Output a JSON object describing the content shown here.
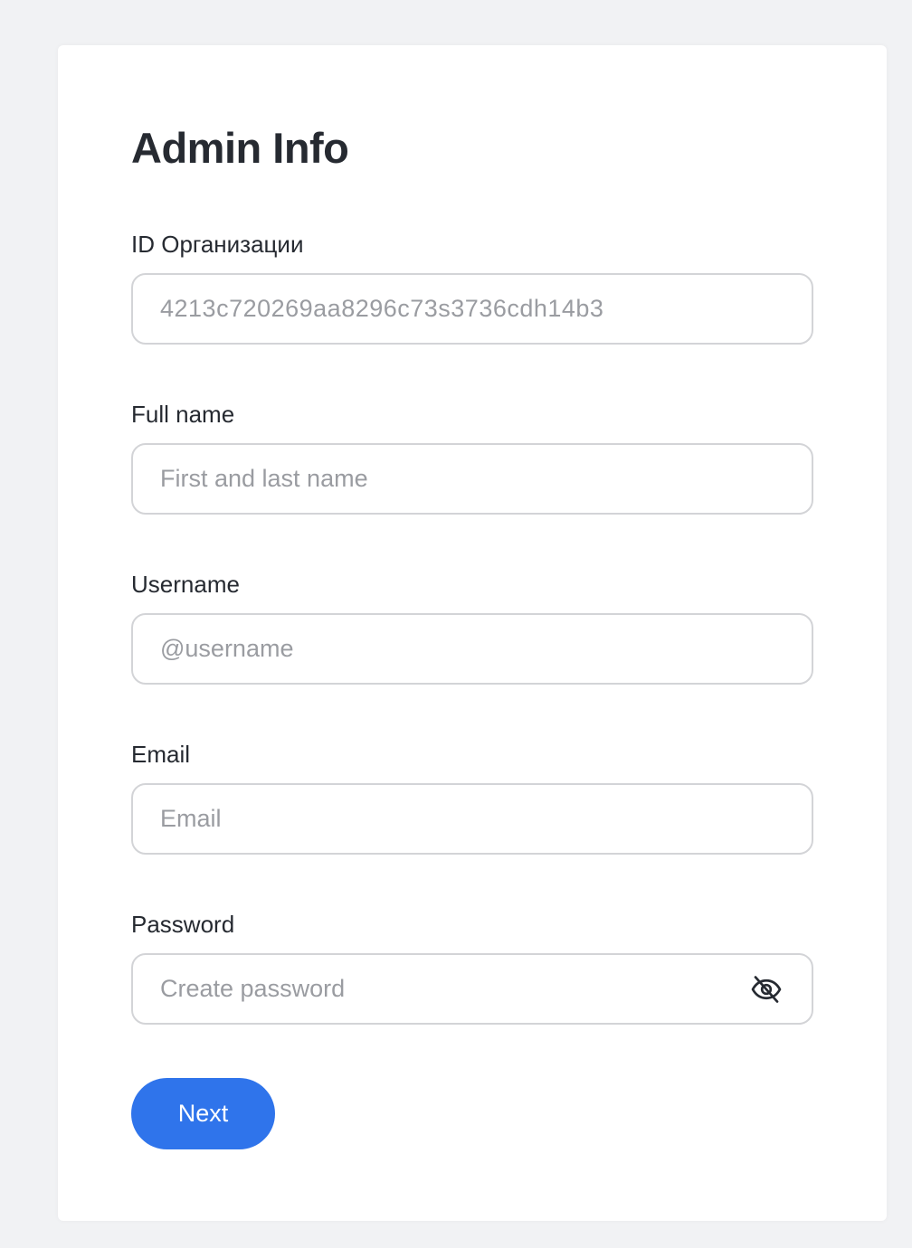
{
  "form": {
    "title": "Admin Info",
    "fields": [
      {
        "label": "ID Организации",
        "value": "4213c720269aa8296c73s3736cdh14b3",
        "placeholder": ""
      },
      {
        "label": "Full name",
        "value": "",
        "placeholder": "First and last name"
      },
      {
        "label": "Username",
        "value": "",
        "placeholder": "@username"
      },
      {
        "label": "Email",
        "value": "",
        "placeholder": "Email"
      },
      {
        "label": "Password",
        "value": "",
        "placeholder": "Create password",
        "icon": "eye-off-icon"
      }
    ],
    "next_label": "Next"
  },
  "colors": {
    "background": "#f1f2f4",
    "primary": "#2f74eb",
    "text": "#262a31",
    "placeholder": "#9a9ca1"
  }
}
